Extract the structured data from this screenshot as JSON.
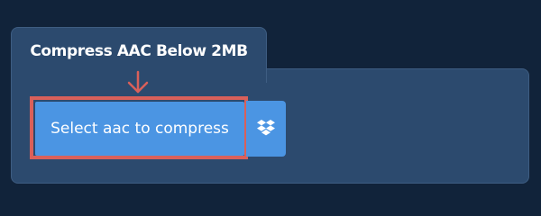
{
  "tab": {
    "title": "Compress AAC Below 2MB"
  },
  "upload": {
    "select_label": "Select aac to compress",
    "dropbox_icon": "dropbox-icon",
    "arrow_icon": "arrow-down-icon"
  },
  "colors": {
    "background": "#11233a",
    "panel": "#2c4a6e",
    "button": "#4b95e3",
    "highlight": "#d9605a"
  }
}
